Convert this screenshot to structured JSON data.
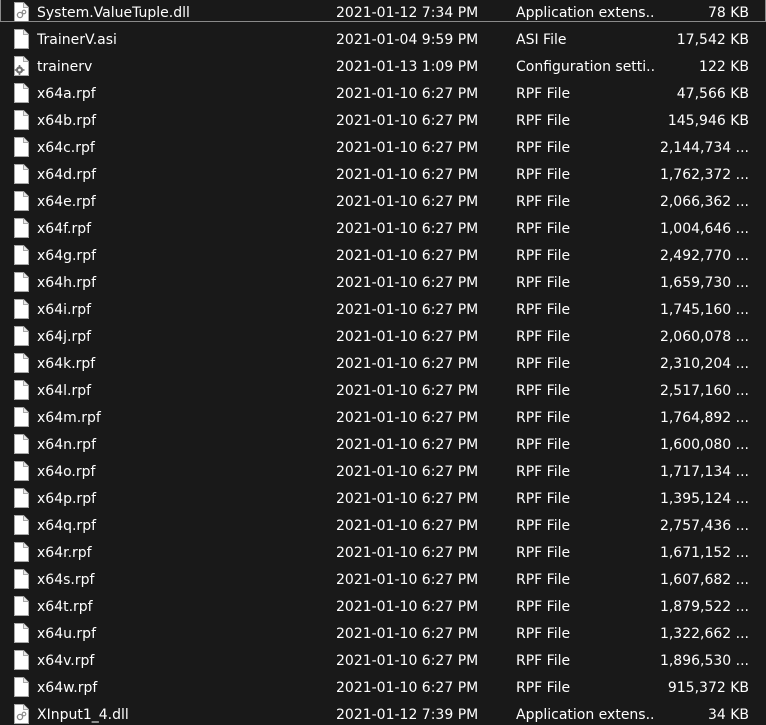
{
  "files": [
    {
      "name": "System.ValueTuple.dll",
      "date": "2021-01-12 7:34 PM",
      "type": "Application extens...",
      "size": "78 KB",
      "icon": "dll-file-icon",
      "selected": true
    },
    {
      "name": "TrainerV.asi",
      "date": "2021-01-04 9:59 PM",
      "type": "ASI File",
      "size": "17,542 KB",
      "icon": "file-icon"
    },
    {
      "name": "trainerv",
      "date": "2021-01-13 1:09 PM",
      "type": "Configuration setti...",
      "size": "122 KB",
      "icon": "config-file-icon"
    },
    {
      "name": "x64a.rpf",
      "date": "2021-01-10 6:27 PM",
      "type": "RPF File",
      "size": "47,566 KB",
      "icon": "file-icon"
    },
    {
      "name": "x64b.rpf",
      "date": "2021-01-10 6:27 PM",
      "type": "RPF File",
      "size": "145,946 KB",
      "icon": "file-icon"
    },
    {
      "name": "x64c.rpf",
      "date": "2021-01-10 6:27 PM",
      "type": "RPF File",
      "size": "2,144,734 ...",
      "icon": "file-icon"
    },
    {
      "name": "x64d.rpf",
      "date": "2021-01-10 6:27 PM",
      "type": "RPF File",
      "size": "1,762,372 ...",
      "icon": "file-icon"
    },
    {
      "name": "x64e.rpf",
      "date": "2021-01-10 6:27 PM",
      "type": "RPF File",
      "size": "2,066,362 ...",
      "icon": "file-icon"
    },
    {
      "name": "x64f.rpf",
      "date": "2021-01-10 6:27 PM",
      "type": "RPF File",
      "size": "1,004,646 ...",
      "icon": "file-icon"
    },
    {
      "name": "x64g.rpf",
      "date": "2021-01-10 6:27 PM",
      "type": "RPF File",
      "size": "2,492,770 ...",
      "icon": "file-icon"
    },
    {
      "name": "x64h.rpf",
      "date": "2021-01-10 6:27 PM",
      "type": "RPF File",
      "size": "1,659,730 ...",
      "icon": "file-icon"
    },
    {
      "name": "x64i.rpf",
      "date": "2021-01-10 6:27 PM",
      "type": "RPF File",
      "size": "1,745,160 ...",
      "icon": "file-icon"
    },
    {
      "name": "x64j.rpf",
      "date": "2021-01-10 6:27 PM",
      "type": "RPF File",
      "size": "2,060,078 ...",
      "icon": "file-icon"
    },
    {
      "name": "x64k.rpf",
      "date": "2021-01-10 6:27 PM",
      "type": "RPF File",
      "size": "2,310,204 ...",
      "icon": "file-icon"
    },
    {
      "name": "x64l.rpf",
      "date": "2021-01-10 6:27 PM",
      "type": "RPF File",
      "size": "2,517,160 ...",
      "icon": "file-icon"
    },
    {
      "name": "x64m.rpf",
      "date": "2021-01-10 6:27 PM",
      "type": "RPF File",
      "size": "1,764,892 ...",
      "icon": "file-icon"
    },
    {
      "name": "x64n.rpf",
      "date": "2021-01-10 6:27 PM",
      "type": "RPF File",
      "size": "1,600,080 ...",
      "icon": "file-icon"
    },
    {
      "name": "x64o.rpf",
      "date": "2021-01-10 6:27 PM",
      "type": "RPF File",
      "size": "1,717,134 ...",
      "icon": "file-icon"
    },
    {
      "name": "x64p.rpf",
      "date": "2021-01-10 6:27 PM",
      "type": "RPF File",
      "size": "1,395,124 ...",
      "icon": "file-icon"
    },
    {
      "name": "x64q.rpf",
      "date": "2021-01-10 6:27 PM",
      "type": "RPF File",
      "size": "2,757,436 ...",
      "icon": "file-icon"
    },
    {
      "name": "x64r.rpf",
      "date": "2021-01-10 6:27 PM",
      "type": "RPF File",
      "size": "1,671,152 ...",
      "icon": "file-icon"
    },
    {
      "name": "x64s.rpf",
      "date": "2021-01-10 6:27 PM",
      "type": "RPF File",
      "size": "1,607,682 ...",
      "icon": "file-icon"
    },
    {
      "name": "x64t.rpf",
      "date": "2021-01-10 6:27 PM",
      "type": "RPF File",
      "size": "1,879,522 ...",
      "icon": "file-icon"
    },
    {
      "name": "x64u.rpf",
      "date": "2021-01-10 6:27 PM",
      "type": "RPF File",
      "size": "1,322,662 ...",
      "icon": "file-icon"
    },
    {
      "name": "x64v.rpf",
      "date": "2021-01-10 6:27 PM",
      "type": "RPF File",
      "size": "1,896,530 ...",
      "icon": "file-icon"
    },
    {
      "name": "x64w.rpf",
      "date": "2021-01-10 6:27 PM",
      "type": "RPF File",
      "size": "915,372 KB",
      "icon": "file-icon"
    },
    {
      "name": "XInput1_4.dll",
      "date": "2021-01-12 7:39 PM",
      "type": "Application extens...",
      "size": "34 KB",
      "icon": "dll-file-icon"
    }
  ],
  "colors": {
    "background": "#191919",
    "text": "#ffffff",
    "selection_border": "#8a8a8a"
  }
}
